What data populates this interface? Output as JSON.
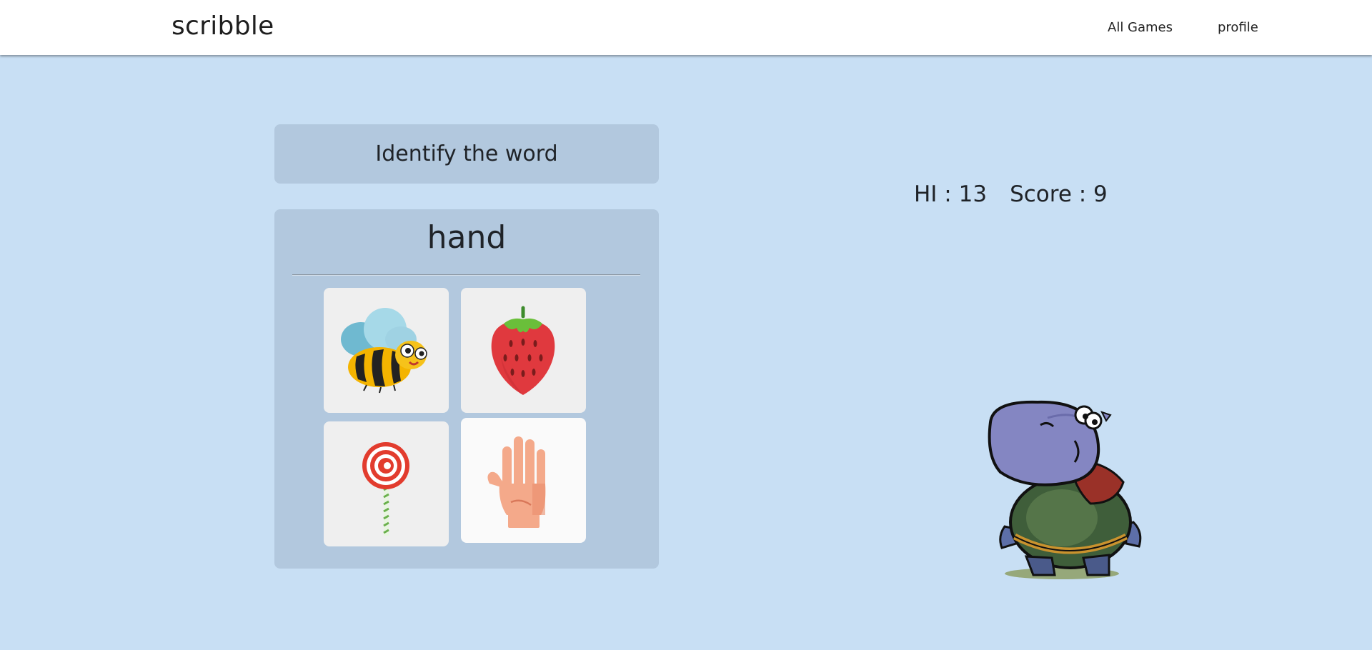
{
  "navbar": {
    "brand": "scribble",
    "links": [
      {
        "label": "All Games"
      },
      {
        "label": "profile"
      }
    ]
  },
  "game": {
    "instruction": "Identify the word",
    "word": "hand",
    "options": [
      {
        "icon": "bee-icon"
      },
      {
        "icon": "strawberry-icon"
      },
      {
        "icon": "lollipop-icon"
      },
      {
        "icon": "hand-icon"
      }
    ]
  },
  "stats": {
    "hi_label": "HI : 13",
    "score_label": "Score : 9"
  },
  "mascot": {
    "icon": "hippo-character-icon"
  },
  "colors": {
    "background": "#c8dff4",
    "card": "#b2c8de",
    "tile": "#efefef",
    "navbar": "#ffffff"
  }
}
